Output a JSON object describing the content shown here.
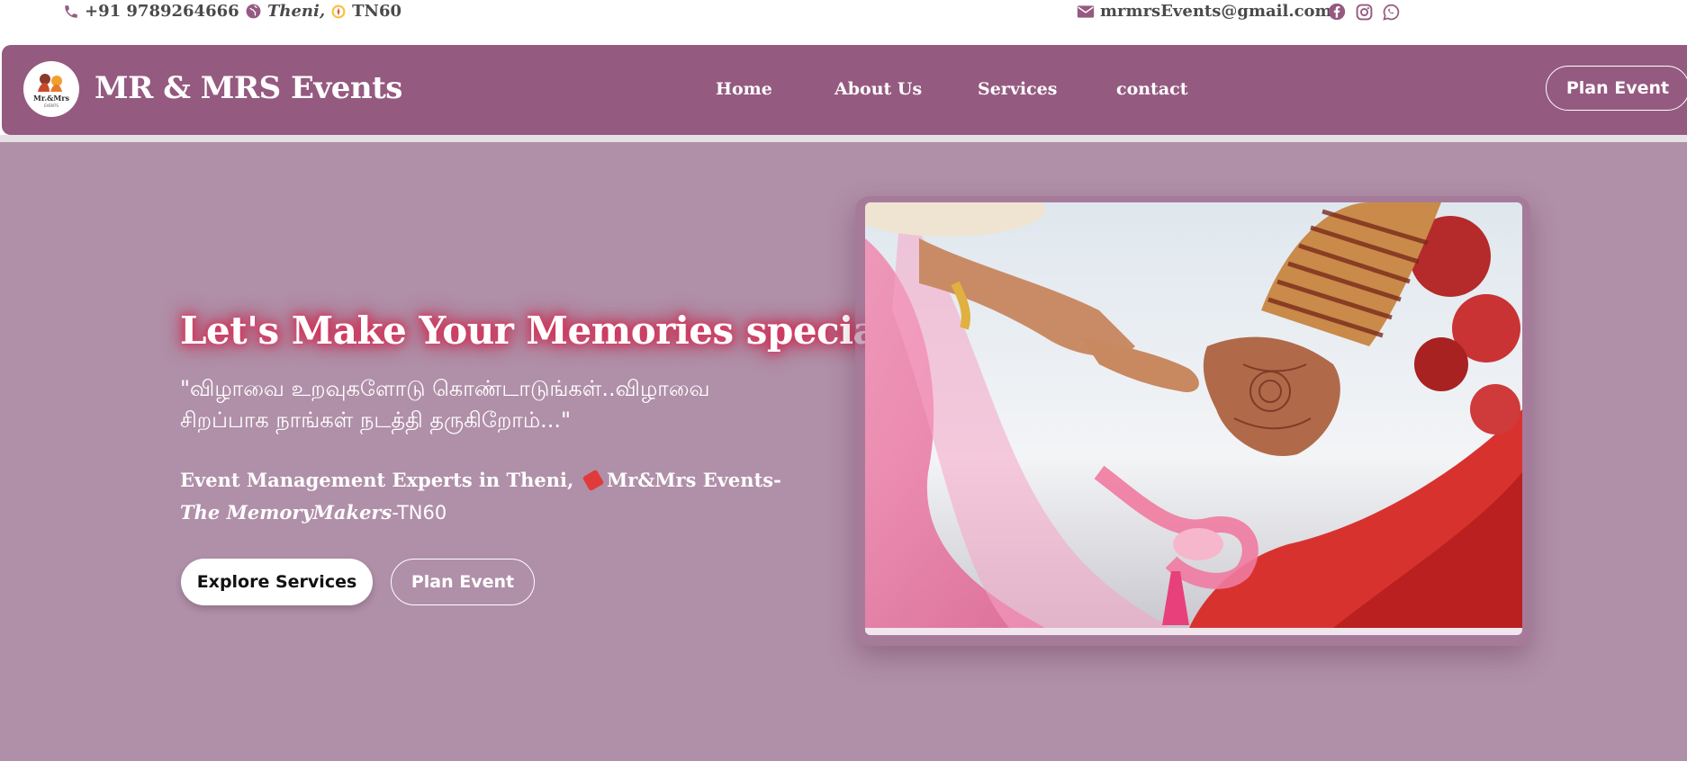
{
  "topbar": {
    "phone": "+91 9789264666",
    "location_city": "Theni,",
    "location_code": "TN60",
    "email": "mrmrsEvents@gmail.com",
    "icons": [
      "phone-icon",
      "globe-icon",
      "compass-icon",
      "envelope-icon",
      "facebook-icon",
      "instagram-icon",
      "whatsapp-icon"
    ]
  },
  "nav": {
    "logo_text": "Mr.&Mrs",
    "brand": "MR & MRS Events",
    "links": [
      "Home",
      "About Us",
      "Services",
      "contact"
    ],
    "cta": "Plan Event"
  },
  "hero": {
    "title": "Let's Make Your Memories special ..",
    "tamil_line1": "\"விழாவை உறவுகளோடு கொண்டாடுங்கள்..விழாவை",
    "tamil_line2": "சிறப்பாக நாங்கள் நடத்தி தருகிறோம்...\"",
    "sub_bold": "Event Management Experts in Theni,",
    "sub_brand": "Mr&Mrs Events-",
    "sub_script": "The MemoryMakers",
    "sub_tail": "-TN60",
    "btn_primary": "Explore Services",
    "btn_secondary": "Plan Event"
  },
  "colors": {
    "brand_purple": "#955a80",
    "hero_bg": "#b08fa8",
    "glow": "#e0305a"
  }
}
